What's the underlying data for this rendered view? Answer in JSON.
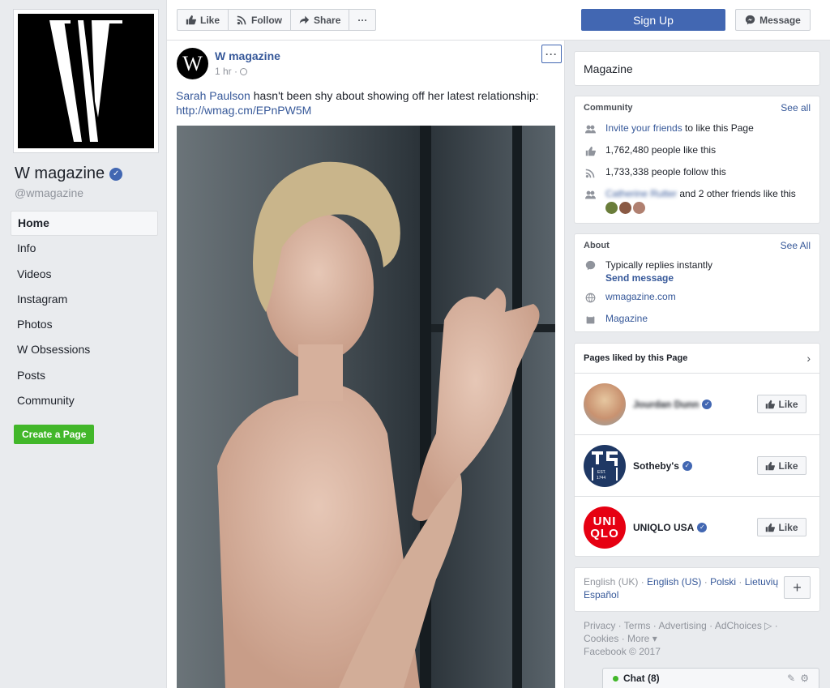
{
  "sidebar": {
    "logo_letter": "W",
    "page_name": "W magazine",
    "handle": "@wmagazine",
    "nav": [
      "Home",
      "Info",
      "Videos",
      "Instagram",
      "Photos",
      "W Obsessions",
      "Posts",
      "Community"
    ],
    "create_page": "Create a Page"
  },
  "topbar": {
    "like": "Like",
    "follow": "Follow",
    "share": "Share",
    "more": "···",
    "signup": "Sign Up",
    "message": "Message"
  },
  "post": {
    "avatar_letter": "W",
    "author": "W magazine",
    "time": "1 hr ·",
    "more": "···",
    "mention": "Sarah Paulson",
    "text": " hasn't been shy about showing off her latest relationship:",
    "url": "http://wmag.cm/EPnPW5M"
  },
  "right": {
    "category": "Magazine",
    "community": {
      "title": "Community",
      "see_all": "See all",
      "invite_link": "Invite your friends",
      "invite_rest": " to like this Page",
      "likes": "1,762,480 people like this",
      "follows": "1,733,338 people follow this",
      "friend_name": "Catherine Rutter",
      "friends_rest": " and 2 other friends like this"
    },
    "about": {
      "title": "About",
      "see_all": "See All",
      "replies": "Typically replies instantly",
      "send_message": "Send message",
      "website": "wmagazine.com",
      "category": "Magazine"
    },
    "pages_liked": {
      "title": "Pages liked by this Page",
      "items": [
        {
          "name": "Jourdan Dunn",
          "like": "Like"
        },
        {
          "name": "Sotheby's",
          "like": "Like"
        },
        {
          "name": "UNIQLO USA",
          "like": "Like"
        }
      ],
      "sothebys_est": "EST.",
      "sothebys_year": "1744",
      "uniqlo_top": "UNI",
      "uniqlo_bottom": "QLO"
    },
    "languages": {
      "current": "English (UK)",
      "others": [
        "English (US)",
        "Polski",
        "Lietuvių",
        "Español"
      ],
      "plus": "+"
    },
    "footer": {
      "line1": "Privacy · Terms · Advertising · AdChoices ▷ ·",
      "line2": "Cookies · More ▾",
      "line3": "Facebook © 2017"
    },
    "chat": "Chat (8)"
  },
  "colors": {
    "brand": "#4267b2",
    "link": "#365899",
    "green": "#42b72a"
  }
}
